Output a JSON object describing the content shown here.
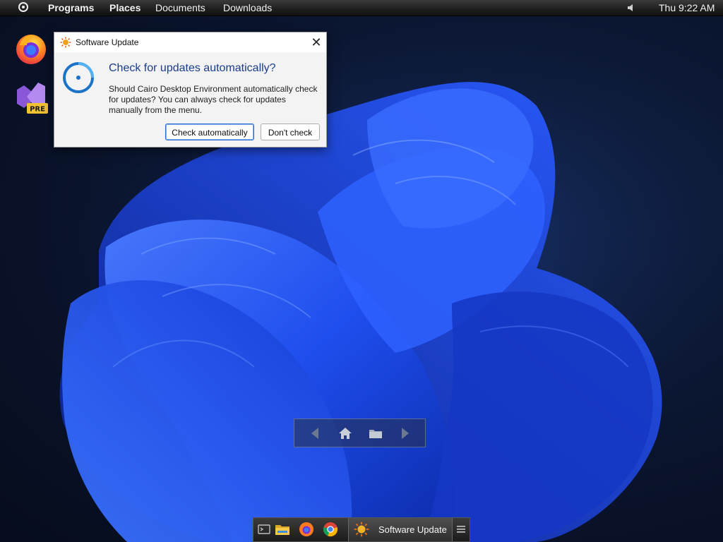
{
  "menubar": {
    "items": [
      "Programs",
      "Places",
      "Documents",
      "Downloads"
    ],
    "clock": "Thu 9:22 AM",
    "icons": {
      "logo": "cairo-logo-icon",
      "volume": "volume-icon"
    }
  },
  "desktop": {
    "icons": [
      {
        "name": "firefox-icon"
      },
      {
        "name": "visual-studio-preview-icon",
        "badge": "PRE"
      }
    ]
  },
  "dialog": {
    "title": "Software Update",
    "close_glyph": "✕",
    "heading": "Check for updates automatically?",
    "message": "Should Cairo Desktop Environment automatically check for updates? You can always check for updates manually from the menu.",
    "buttons": {
      "primary": "Check automatically",
      "secondary": "Don't check"
    }
  },
  "taskbar": {
    "active_task": "Software Update",
    "pinned": [
      "terminal-icon",
      "file-explorer-icon",
      "firefox-icon",
      "chrome-icon"
    ]
  },
  "colors": {
    "accent": "#1a3c8c",
    "menubar": "#2a2a2a",
    "wallpaper_blue": "#1b47e0"
  }
}
